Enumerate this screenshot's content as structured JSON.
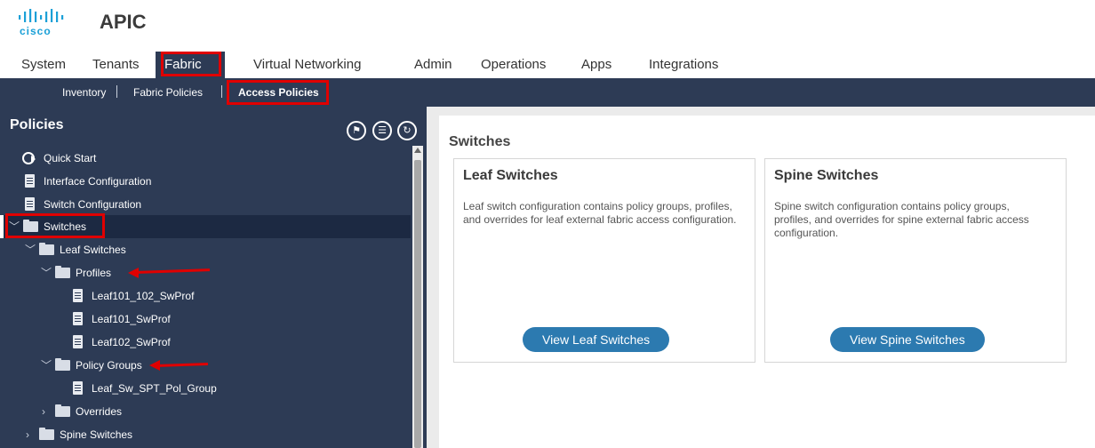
{
  "app": {
    "brand": "cisco",
    "title": "APIC"
  },
  "main_tabs": [
    "System",
    "Tenants",
    "Fabric",
    "Virtual Networking",
    "Admin",
    "Operations",
    "Apps",
    "Integrations"
  ],
  "active_main_tab": "Fabric",
  "sub_nav": [
    "Inventory",
    "Fabric Policies",
    "Access Policies"
  ],
  "active_sub_nav": "Access Policies",
  "left_panel": {
    "title": "Policies",
    "tool_icons": [
      "quick-start-flag-icon",
      "list-filter-icon",
      "refresh-icon"
    ],
    "tree": [
      {
        "label": "Quick Start",
        "icon": "quick-start-icon"
      },
      {
        "label": "Interface Configuration",
        "icon": "document-icon"
      },
      {
        "label": "Switch Configuration",
        "icon": "document-icon"
      },
      {
        "label": "Switches",
        "icon": "folder-icon",
        "expanded": true,
        "selected": true
      },
      {
        "label": "Leaf Switches",
        "icon": "folder-icon",
        "expanded": true
      },
      {
        "label": "Profiles",
        "icon": "folder-icon",
        "expanded": true
      },
      {
        "label": "Leaf101_102_SwProf",
        "icon": "document-icon"
      },
      {
        "label": "Leaf101_SwProf",
        "icon": "document-icon"
      },
      {
        "label": "Leaf102_SwProf",
        "icon": "document-icon"
      },
      {
        "label": "Policy Groups",
        "icon": "folder-icon",
        "expanded": true
      },
      {
        "label": "Leaf_Sw_SPT_Pol_Group",
        "icon": "document-icon"
      },
      {
        "label": "Overrides",
        "icon": "folder-icon",
        "expanded": false
      },
      {
        "label": "Spine Switches",
        "icon": "folder-icon",
        "expanded": false
      }
    ]
  },
  "right_pane": {
    "title": "Switches",
    "cards": [
      {
        "title": "Leaf Switches",
        "description": "Leaf switch configuration contains policy groups, profiles, and overrides for leaf external fabric access configuration.",
        "button": "View Leaf Switches"
      },
      {
        "title": "Spine Switches",
        "description": "Spine switch configuration contains policy groups, profiles, and overrides for spine external fabric access configuration.",
        "button": "View Spine Switches"
      }
    ]
  },
  "colors": {
    "nav_dark": "#2d3b55",
    "highlight_red": "#e00000",
    "button_blue": "#2c7ab0"
  }
}
